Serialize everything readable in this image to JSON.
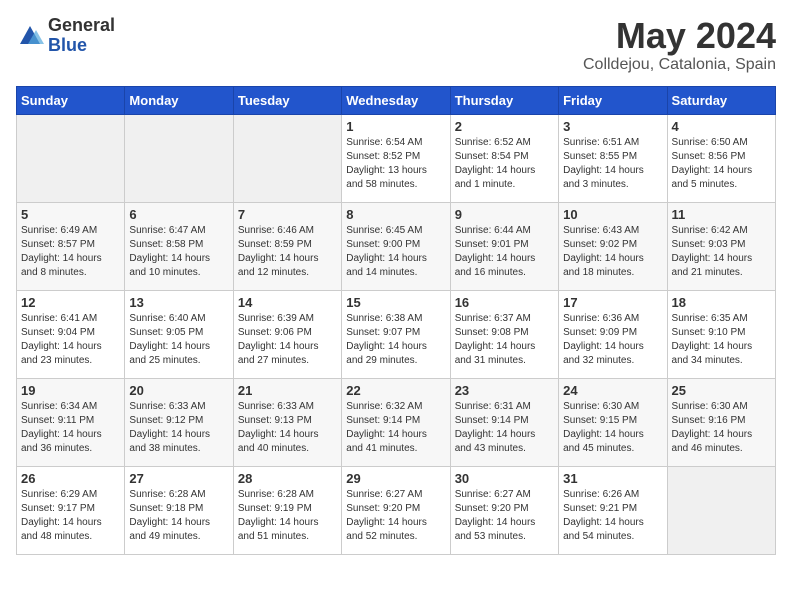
{
  "logo": {
    "general": "General",
    "blue": "Blue"
  },
  "title": "May 2024",
  "location": "Colldejou, Catalonia, Spain",
  "days_of_week": [
    "Sunday",
    "Monday",
    "Tuesday",
    "Wednesday",
    "Thursday",
    "Friday",
    "Saturday"
  ],
  "weeks": [
    [
      {
        "day": "",
        "info": ""
      },
      {
        "day": "",
        "info": ""
      },
      {
        "day": "",
        "info": ""
      },
      {
        "day": "1",
        "info": "Sunrise: 6:54 AM\nSunset: 8:52 PM\nDaylight: 13 hours\nand 58 minutes."
      },
      {
        "day": "2",
        "info": "Sunrise: 6:52 AM\nSunset: 8:54 PM\nDaylight: 14 hours\nand 1 minute."
      },
      {
        "day": "3",
        "info": "Sunrise: 6:51 AM\nSunset: 8:55 PM\nDaylight: 14 hours\nand 3 minutes."
      },
      {
        "day": "4",
        "info": "Sunrise: 6:50 AM\nSunset: 8:56 PM\nDaylight: 14 hours\nand 5 minutes."
      }
    ],
    [
      {
        "day": "5",
        "info": "Sunrise: 6:49 AM\nSunset: 8:57 PM\nDaylight: 14 hours\nand 8 minutes."
      },
      {
        "day": "6",
        "info": "Sunrise: 6:47 AM\nSunset: 8:58 PM\nDaylight: 14 hours\nand 10 minutes."
      },
      {
        "day": "7",
        "info": "Sunrise: 6:46 AM\nSunset: 8:59 PM\nDaylight: 14 hours\nand 12 minutes."
      },
      {
        "day": "8",
        "info": "Sunrise: 6:45 AM\nSunset: 9:00 PM\nDaylight: 14 hours\nand 14 minutes."
      },
      {
        "day": "9",
        "info": "Sunrise: 6:44 AM\nSunset: 9:01 PM\nDaylight: 14 hours\nand 16 minutes."
      },
      {
        "day": "10",
        "info": "Sunrise: 6:43 AM\nSunset: 9:02 PM\nDaylight: 14 hours\nand 18 minutes."
      },
      {
        "day": "11",
        "info": "Sunrise: 6:42 AM\nSunset: 9:03 PM\nDaylight: 14 hours\nand 21 minutes."
      }
    ],
    [
      {
        "day": "12",
        "info": "Sunrise: 6:41 AM\nSunset: 9:04 PM\nDaylight: 14 hours\nand 23 minutes."
      },
      {
        "day": "13",
        "info": "Sunrise: 6:40 AM\nSunset: 9:05 PM\nDaylight: 14 hours\nand 25 minutes."
      },
      {
        "day": "14",
        "info": "Sunrise: 6:39 AM\nSunset: 9:06 PM\nDaylight: 14 hours\nand 27 minutes."
      },
      {
        "day": "15",
        "info": "Sunrise: 6:38 AM\nSunset: 9:07 PM\nDaylight: 14 hours\nand 29 minutes."
      },
      {
        "day": "16",
        "info": "Sunrise: 6:37 AM\nSunset: 9:08 PM\nDaylight: 14 hours\nand 31 minutes."
      },
      {
        "day": "17",
        "info": "Sunrise: 6:36 AM\nSunset: 9:09 PM\nDaylight: 14 hours\nand 32 minutes."
      },
      {
        "day": "18",
        "info": "Sunrise: 6:35 AM\nSunset: 9:10 PM\nDaylight: 14 hours\nand 34 minutes."
      }
    ],
    [
      {
        "day": "19",
        "info": "Sunrise: 6:34 AM\nSunset: 9:11 PM\nDaylight: 14 hours\nand 36 minutes."
      },
      {
        "day": "20",
        "info": "Sunrise: 6:33 AM\nSunset: 9:12 PM\nDaylight: 14 hours\nand 38 minutes."
      },
      {
        "day": "21",
        "info": "Sunrise: 6:33 AM\nSunset: 9:13 PM\nDaylight: 14 hours\nand 40 minutes."
      },
      {
        "day": "22",
        "info": "Sunrise: 6:32 AM\nSunset: 9:14 PM\nDaylight: 14 hours\nand 41 minutes."
      },
      {
        "day": "23",
        "info": "Sunrise: 6:31 AM\nSunset: 9:14 PM\nDaylight: 14 hours\nand 43 minutes."
      },
      {
        "day": "24",
        "info": "Sunrise: 6:30 AM\nSunset: 9:15 PM\nDaylight: 14 hours\nand 45 minutes."
      },
      {
        "day": "25",
        "info": "Sunrise: 6:30 AM\nSunset: 9:16 PM\nDaylight: 14 hours\nand 46 minutes."
      }
    ],
    [
      {
        "day": "26",
        "info": "Sunrise: 6:29 AM\nSunset: 9:17 PM\nDaylight: 14 hours\nand 48 minutes."
      },
      {
        "day": "27",
        "info": "Sunrise: 6:28 AM\nSunset: 9:18 PM\nDaylight: 14 hours\nand 49 minutes."
      },
      {
        "day": "28",
        "info": "Sunrise: 6:28 AM\nSunset: 9:19 PM\nDaylight: 14 hours\nand 51 minutes."
      },
      {
        "day": "29",
        "info": "Sunrise: 6:27 AM\nSunset: 9:20 PM\nDaylight: 14 hours\nand 52 minutes."
      },
      {
        "day": "30",
        "info": "Sunrise: 6:27 AM\nSunset: 9:20 PM\nDaylight: 14 hours\nand 53 minutes."
      },
      {
        "day": "31",
        "info": "Sunrise: 6:26 AM\nSunset: 9:21 PM\nDaylight: 14 hours\nand 54 minutes."
      },
      {
        "day": "",
        "info": ""
      }
    ]
  ]
}
